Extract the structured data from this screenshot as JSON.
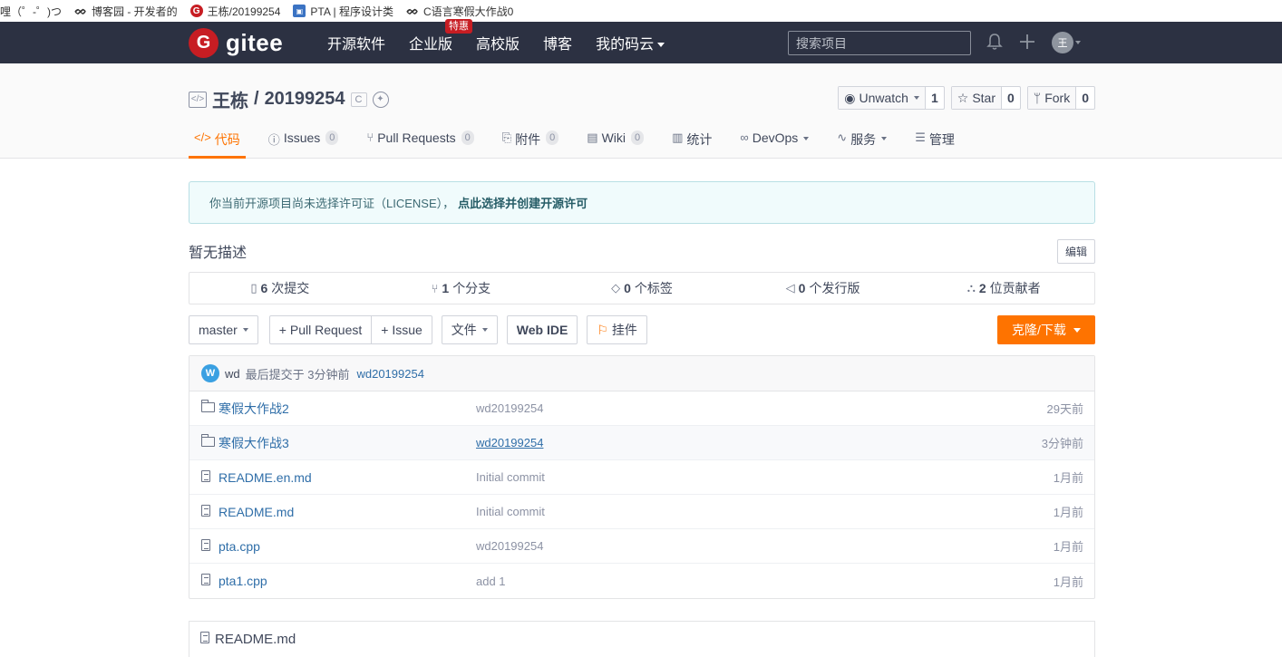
{
  "bookmarks": [
    {
      "icon": "",
      "label": "哩（゜-゜)つ"
    },
    {
      "icon": "cnblogs",
      "label": "博客园 - 开发者的"
    },
    {
      "icon": "gitee",
      "label": "王栋/20199254"
    },
    {
      "icon": "pta",
      "label": "PTA | 程序设计类"
    },
    {
      "icon": "cnblogs",
      "label": "C语言寒假大作战0"
    }
  ],
  "topnav": {
    "logo_text": "gitee",
    "links": [
      "开源软件",
      "企业版",
      "高校版",
      "博客",
      "我的码云"
    ],
    "hot_badge": "特惠",
    "search_placeholder": "搜索项目",
    "avatar_text": "王"
  },
  "repo": {
    "owner": "王栋",
    "name": "20199254",
    "lang": "C",
    "watch_label": "Unwatch",
    "watch_count": "1",
    "star_label": "Star",
    "star_count": "0",
    "fork_label": "Fork",
    "fork_count": "0"
  },
  "tabs": [
    {
      "label": "代码",
      "count": null
    },
    {
      "label": "Issues",
      "count": "0"
    },
    {
      "label": "Pull Requests",
      "count": "0"
    },
    {
      "label": "附件",
      "count": "0"
    },
    {
      "label": "Wiki",
      "count": "0"
    },
    {
      "label": "统计",
      "count": null
    },
    {
      "label": "DevOps",
      "count": null
    },
    {
      "label": "服务",
      "count": null
    },
    {
      "label": "管理",
      "count": null
    }
  ],
  "license": {
    "text": "你当前开源项目尚未选择许可证（LICENSE），",
    "link": "点此选择并创建开源许可"
  },
  "description": {
    "text": "暂无描述",
    "edit_label": "编辑"
  },
  "stats": [
    {
      "num": "6",
      "label": "次提交"
    },
    {
      "num": "1",
      "label": "个分支"
    },
    {
      "num": "0",
      "label": "个标签"
    },
    {
      "num": "0",
      "label": "个发行版"
    },
    {
      "num": "2",
      "label": "位贡献者"
    }
  ],
  "toolbar": {
    "branch": "master",
    "pull_request": "+ Pull Request",
    "issue": "+ Issue",
    "files": "文件",
    "web_ide": "Web IDE",
    "widget": "挂件",
    "clone": "克隆/下载"
  },
  "last_commit": {
    "avatar": "W",
    "author": "wd",
    "text": "最后提交于 3分钟前",
    "message": "wd20199254"
  },
  "files": [
    {
      "type": "folder",
      "name": "寒假大作战2",
      "message": "wd20199254",
      "time": "29天前"
    },
    {
      "type": "folder",
      "name": "寒假大作战3",
      "message": "wd20199254",
      "time": "3分钟前"
    },
    {
      "type": "file",
      "name": "README.en.md",
      "message": "Initial commit",
      "time": "1月前"
    },
    {
      "type": "file",
      "name": "README.md",
      "message": "Initial commit",
      "time": "1月前"
    },
    {
      "type": "file",
      "name": "pta.cpp",
      "message": "wd20199254",
      "time": "1月前"
    },
    {
      "type": "file",
      "name": "pta1.cpp",
      "message": "add 1",
      "time": "1月前"
    }
  ],
  "readme_title": "README.md"
}
